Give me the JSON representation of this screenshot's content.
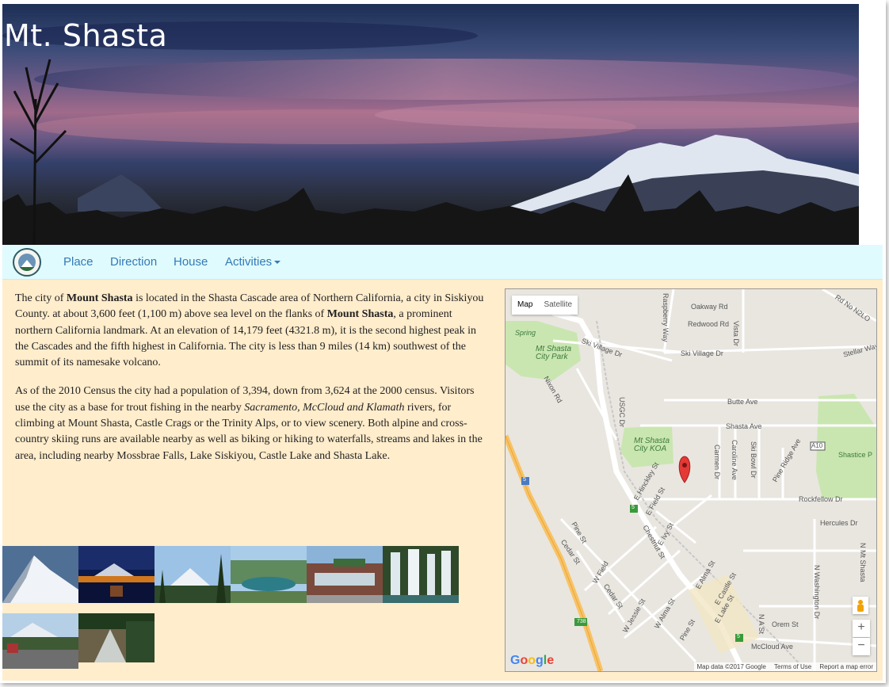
{
  "header": {
    "title": "Mt. Shasta"
  },
  "nav": {
    "items": [
      "Place",
      "Direction",
      "House"
    ],
    "dropdown_label": "Activities"
  },
  "article": {
    "p1": [
      {
        "t": "The city of ",
        "b": false,
        "i": false
      },
      {
        "t": "Mount Shasta",
        "b": true,
        "i": false
      },
      {
        "t": " is located in the Shasta Cascade area of Northern California, a city in Siskiyou County. at about 3,600 feet (1,100 m) above sea level on the flanks of ",
        "b": false,
        "i": false
      },
      {
        "t": "Mount Shasta",
        "b": true,
        "i": false
      },
      {
        "t": ", a prominent northern California landmark. At an elevation of 14,179 feet (4321.8 m), it is the second highest peak in the Cascades and the fifth highest in California. The city is less than 9 miles (14 km) southwest of the summit of its namesake volcano.",
        "b": false,
        "i": false
      }
    ],
    "p2": [
      {
        "t": "As of the 2010 Census the city had a population of 3,394, down from 3,624 at the 2000 census. Visitors use the city as a base for trout fishing in the nearby ",
        "b": false,
        "i": false
      },
      {
        "t": "Sacramento, McCloud and Klamath",
        "b": false,
        "i": true
      },
      {
        "t": " rivers, for climbing at Mount Shasta, Castle Crags or the Trinity Alps, or to view scenery. Both alpine and cross-country skiing runs are available nearby as well as biking or hiking to waterfalls, streams and lakes in the area, including nearby Mossbrae Falls, Lake Siskiyou, Castle Lake and Shasta Lake.",
        "b": false,
        "i": false
      }
    ]
  },
  "gallery": {
    "thumbnails": [
      "snowy-peak",
      "lake-at-dusk",
      "forest-view",
      "lake-siskiyou",
      "storefront",
      "waterfall",
      "town-street",
      "creek"
    ]
  },
  "map": {
    "type_map": "Map",
    "type_satellite": "Satellite",
    "labels": [
      "Oakway Rd",
      "Redwood Rd",
      "Vista Dr",
      "Raspberry Way",
      "Rd No N2LO",
      "Ski Village Dr",
      "Ski Village Dr",
      "Mt Shasta City Park",
      "Spring",
      "Nixon Rd",
      "Stellar Way",
      "Butte Ave",
      "Shasta Ave",
      "A10",
      "Mt Shasta City KOA",
      "Carmen Dr",
      "Caroline Ave",
      "Ski Bowl Dr",
      "Pine Ridge Ave",
      "Shastice P",
      "E Hinckley St",
      "E Field St",
      "Rockfellow Dr",
      "Hercules Dr",
      "Pine St",
      "Cedar St",
      "E Ivy St",
      "Chestnut St",
      "W Field",
      "Cedar St",
      "W Jessie St",
      "W Alma St",
      "E Alma St",
      "E Castle St",
      "E Lake St",
      "N A St",
      "Orem St",
      "McCloud Ave",
      "N Washington Dr",
      "N Mt Shasta",
      "Pine St",
      "738",
      "5",
      "5",
      "5",
      "USGC Dr"
    ],
    "zoom_in": "+",
    "zoom_out": "−",
    "google": "Google",
    "attribution_data": "Map data ©2017 Google",
    "attribution_terms": "Terms of Use",
    "attribution_report": "Report a map error"
  },
  "colors": {
    "nav_bg": "#e0fbfd",
    "nav_link": "#337ab7",
    "content_bg": "#ffedcc",
    "map_park": "#c9e6b0",
    "map_highway": "#f8c266",
    "marker": "#e53935"
  }
}
